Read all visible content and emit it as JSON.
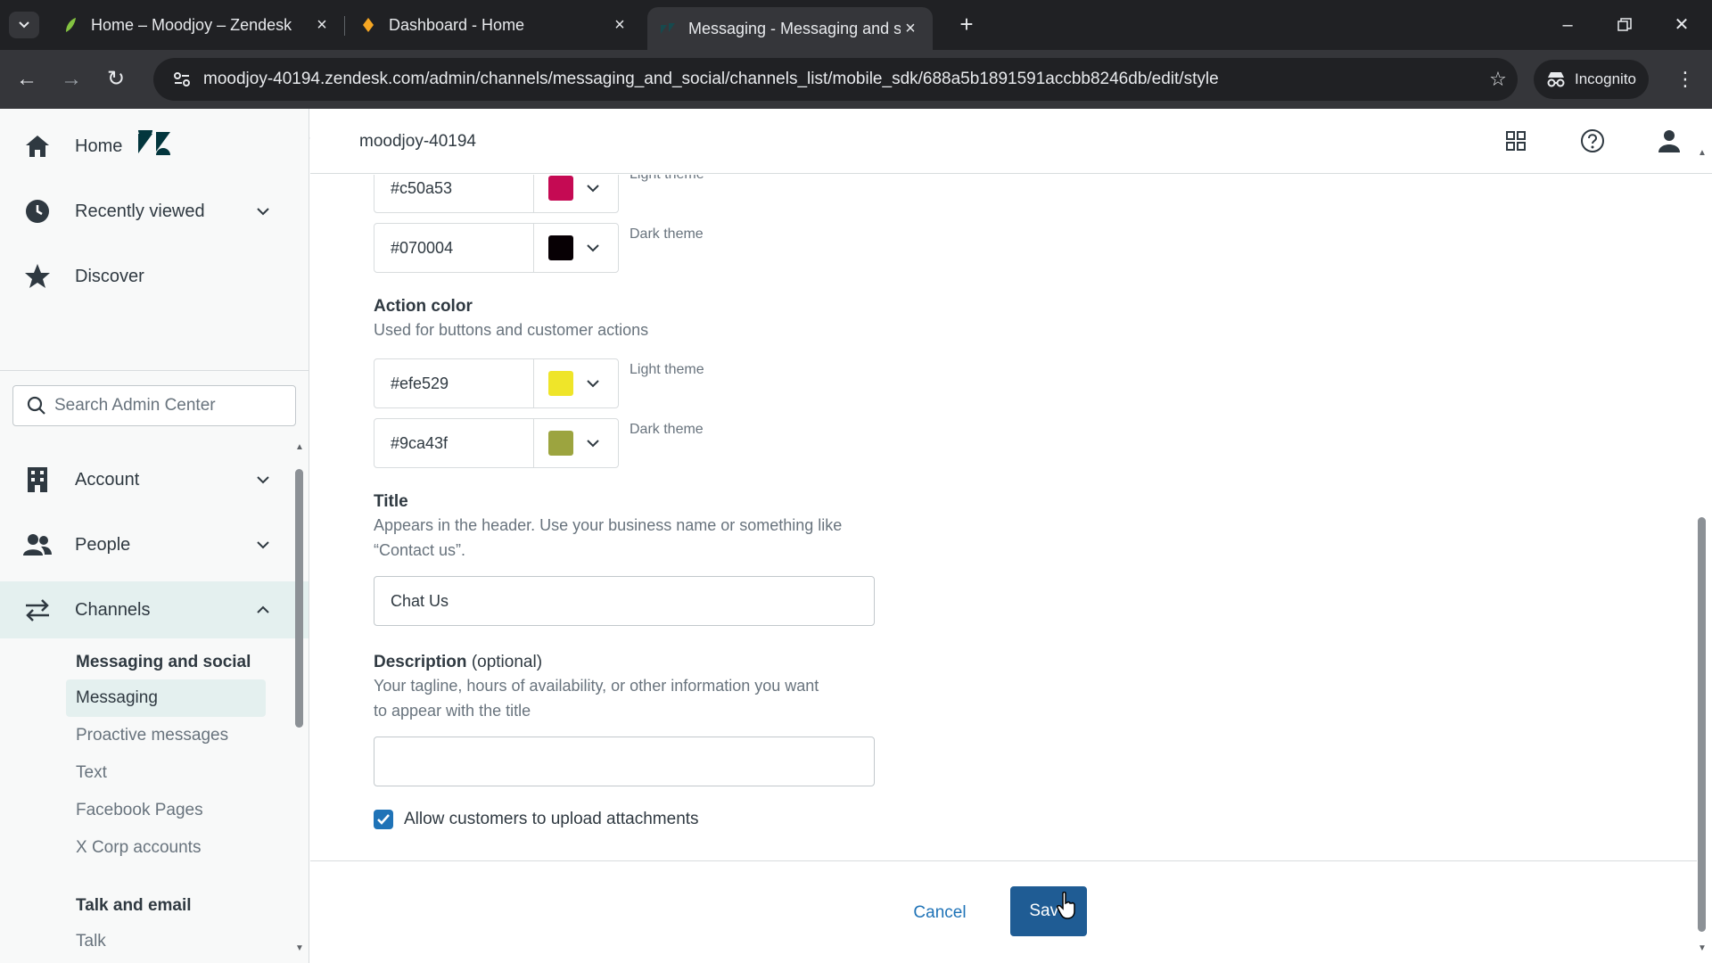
{
  "browser": {
    "tabs": [
      {
        "title": "Home – Moodjoy – Zendesk"
      },
      {
        "title": "Dashboard - Home"
      },
      {
        "title": "Messaging - Messaging and so"
      }
    ],
    "url": "moodjoy-40194.zendesk.com/admin/channels/messaging_and_social/channels_list/mobile_sdk/688a5b1891591accbb8246db/edit/style",
    "profile_label": "Incognito"
  },
  "sidebar": {
    "home": "Home",
    "recently_viewed": "Recently viewed",
    "discover": "Discover",
    "search_placeholder": "Search Admin Center",
    "account": "Account",
    "people": "People",
    "channels": "Channels",
    "messaging_and_social": "Messaging and social",
    "sub_items": [
      "Messaging",
      "Proactive messages",
      "Text",
      "Facebook Pages",
      "X Corp accounts"
    ],
    "talk_and_email": "Talk and email",
    "talk": "Talk"
  },
  "header": {
    "subdomain": "moodjoy-40194"
  },
  "form": {
    "primary_color": {
      "light": {
        "hex": "#c50a53",
        "label": "Light theme",
        "swatch": "#c50a53"
      },
      "dark": {
        "hex": "#070004",
        "label": "Dark theme",
        "swatch": "#070004"
      }
    },
    "action_color": {
      "label": "Action color",
      "hint": "Used for buttons and customer actions",
      "light": {
        "hex": "#efe529",
        "label": "Light theme",
        "swatch": "#efe529"
      },
      "dark": {
        "hex": "#9ca43f",
        "label": "Dark theme",
        "swatch": "#9ca43f"
      }
    },
    "title": {
      "label": "Title",
      "hint_line1": "Appears in the header. Use your business name or something like",
      "hint_line2": "“Contact us”.",
      "value": "Chat Us"
    },
    "description": {
      "label": "Description",
      "optional": "(optional)",
      "hint_line1": "Your tagline, hours of availability, or other information you want",
      "hint_line2": "to appear with the title",
      "value": ""
    },
    "attachments": {
      "label": "Allow customers to upload attachments",
      "checked": true
    }
  },
  "footer": {
    "cancel": "Cancel",
    "save": "Save"
  },
  "colors": {
    "accent": "#1f73b7",
    "save_button": "#1f5c94",
    "active_nav": "#e4f0ef"
  }
}
